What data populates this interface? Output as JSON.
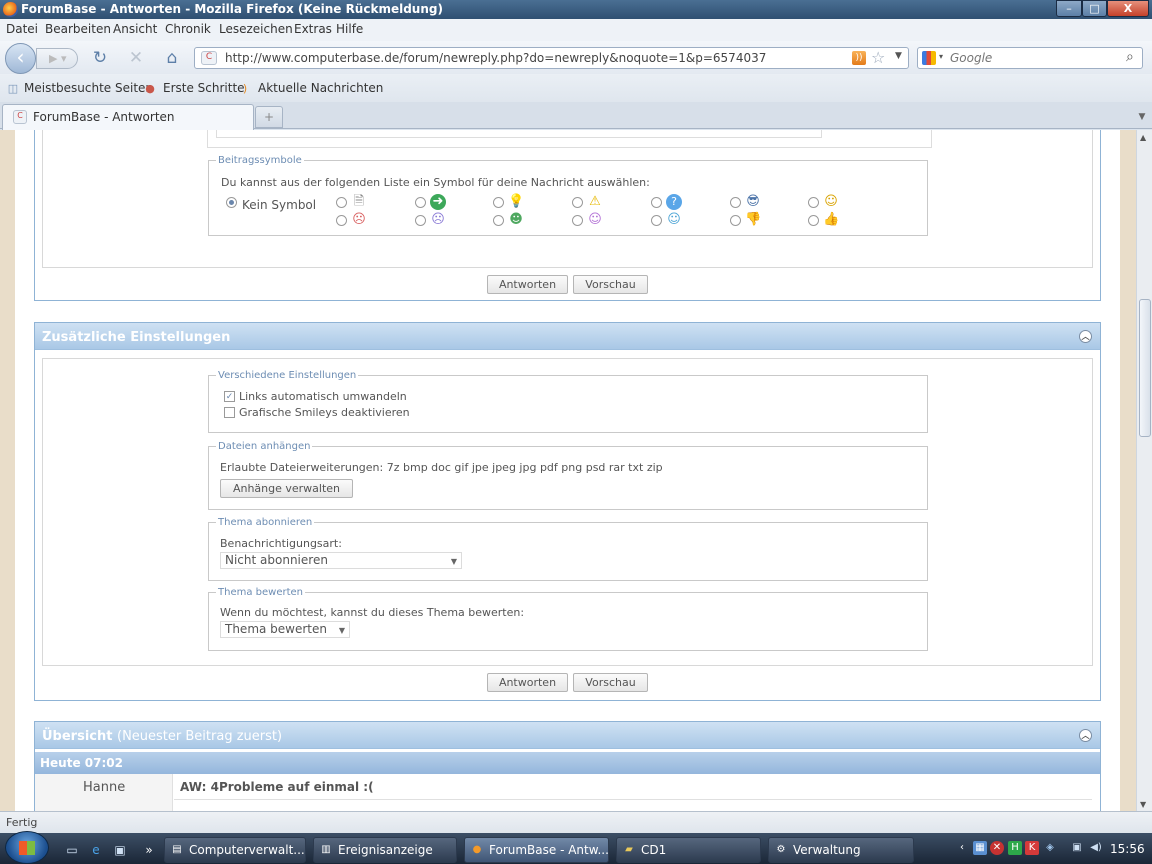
{
  "window": {
    "title": "ForumBase - Antworten - Mozilla Firefox (Keine Rückmeldung)",
    "min": "–",
    "max": "□",
    "close": "X"
  },
  "menu": [
    "Datei",
    "Bearbeiten",
    "Ansicht",
    "Chronik",
    "Lesezeichen",
    "Extras",
    "Hilfe"
  ],
  "nav": {
    "url": "http://www.computerbase.de/forum/newreply.php?do=newreply&noquote=1&p=6574037",
    "search_placeholder": "Google"
  },
  "bookmarks": [
    "Meistbesuchte Seiten",
    "Erste Schritte",
    "Aktuelle Nachrichten"
  ],
  "tab": {
    "label": "ForumBase - Antworten",
    "new_tab": "+"
  },
  "symbols": {
    "legend": "Beitragssymbole",
    "prompt": "Du kannst aus der folgenden Liste ein Symbol für deine Nachricht auswählen:",
    "none_label": "Kein Symbol",
    "selected": "Kein Symbol",
    "row1_icons": [
      "page-icon",
      "arrow-icon",
      "lightbulb-icon",
      "warning-icon",
      "question-icon",
      "cool-smiley-icon",
      "smile-icon"
    ],
    "row2_icons": [
      "angry-icon",
      "sad-icon",
      "grin-icon",
      "laugh-icon",
      "wink-icon",
      "thumbs-down-icon",
      "thumbs-up-icon"
    ]
  },
  "buttons": {
    "reply": "Antworten",
    "preview": "Vorschau"
  },
  "extra": {
    "title": "Zusätzliche Einstellungen",
    "misc": {
      "legend": "Verschiedene Einstellungen",
      "links_label": "Links automatisch umwandeln",
      "links_checked": true,
      "smileys_label": "Grafische Smileys deaktivieren",
      "smileys_checked": false
    },
    "attach": {
      "legend": "Dateien anhängen",
      "allowed": "Erlaubte Dateierweiterungen: 7z bmp doc gif jpe jpeg jpg pdf png psd rar txt zip",
      "manage_button": "Anhänge verwalten"
    },
    "subscribe": {
      "legend": "Thema abonnieren",
      "label": "Benachrichtigungsart:",
      "value": "Nicht abonnieren"
    },
    "rate": {
      "legend": "Thema bewerten",
      "label": "Wenn du möchtest, kannst du dieses Thema bewerten:",
      "value": "Thema bewerten"
    }
  },
  "overview": {
    "title": "Übersicht",
    "subtitle": "(Neuester Beitrag zuerst)",
    "date": "Heute 07:02",
    "author": "Hanne",
    "post_title": "AW: 4Probleme auf einmal :("
  },
  "status": "Fertig",
  "taskbar": {
    "tasks": [
      "Computerverwalt...",
      "Ereignisanzeige",
      "ForumBase - Antw...",
      "CD1",
      "Verwaltung"
    ],
    "clock": "15:56"
  },
  "colors": {
    "panel_header": "#a9c8e6",
    "legend_text": "#6d8db3",
    "page_gutter": "#e9ddc9"
  }
}
